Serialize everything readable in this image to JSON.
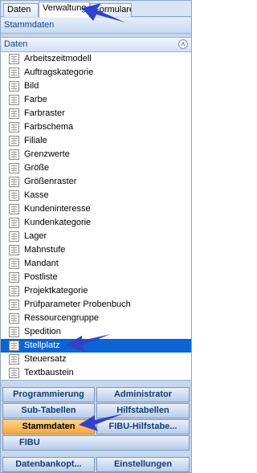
{
  "tabs": [
    {
      "label": "Daten"
    },
    {
      "label": "Verwaltung"
    },
    {
      "label": "Formulare"
    }
  ],
  "header_title": "Stammdaten",
  "section_title": "Daten",
  "list_items": [
    "Arbeitszeitmodell",
    "Auftragskategorie",
    "Bild",
    "Farbe",
    "Farbraster",
    "Farbschema",
    "Filiale",
    "Grenzwerte",
    "Größe",
    "Größenraster",
    "Kasse",
    "Kundeninteresse",
    "Kundenkategorie",
    "Lager",
    "Mahnstufe",
    "Mandant",
    "Postliste",
    "Projektkategorie",
    "Prüfparameter Probenbuch",
    "Ressourcengruppe",
    "Spedition",
    "Stellplatz",
    "Steuersatz",
    "Textbaustein"
  ],
  "selected_item": "Stellplatz",
  "nav_buttons": {
    "programmierung": "Programmierung",
    "administrator": "Administrator",
    "sub_tabellen": "Sub-Tabellen",
    "hilfstabellen": "Hilfstabellen",
    "stammdaten": "Stammdaten",
    "fibu_hilfstabellen": "FIBU-Hilfstabe...",
    "fibu": "FIBU",
    "datenbankoptionen": "Datenbankopt...",
    "einstellungen": "Einstellungen"
  },
  "colors": {
    "selection": "#0a64d6",
    "active_nav": "#f7a73c",
    "arrow": "#3340c8"
  }
}
